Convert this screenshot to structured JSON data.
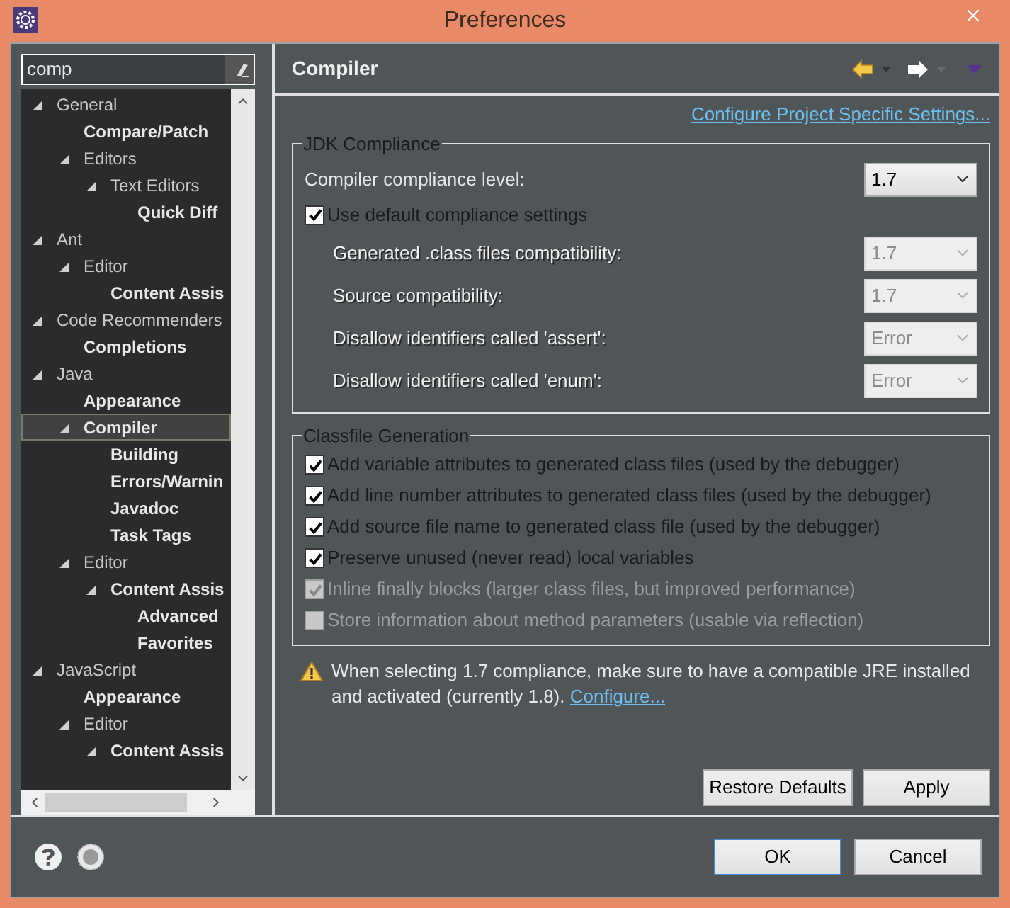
{
  "window": {
    "title": "Preferences"
  },
  "filter": {
    "value": "comp"
  },
  "tree": [
    {
      "label": "General",
      "matched": false,
      "expanded": true,
      "selected": false,
      "children": [
        {
          "label": "Compare/Patch",
          "matched": true,
          "selected": false
        },
        {
          "label": "Editors",
          "matched": false,
          "expanded": true,
          "selected": false,
          "children": [
            {
              "label": "Text Editors",
              "matched": false,
              "expanded": true,
              "selected": false,
              "children": [
                {
                  "label": "Quick Diff",
                  "matched": true,
                  "selected": false
                }
              ]
            }
          ]
        }
      ]
    },
    {
      "label": "Ant",
      "matched": false,
      "expanded": true,
      "selected": false,
      "children": [
        {
          "label": "Editor",
          "matched": false,
          "expanded": true,
          "selected": false,
          "children": [
            {
              "label": "Content Assis",
              "matched": true,
              "selected": false
            }
          ]
        }
      ]
    },
    {
      "label": "Code Recommenders",
      "matched": false,
      "expanded": true,
      "selected": false,
      "children": [
        {
          "label": "Completions",
          "matched": true,
          "selected": false
        }
      ]
    },
    {
      "label": "Java",
      "matched": false,
      "expanded": true,
      "selected": false,
      "children": [
        {
          "label": "Appearance",
          "matched": true,
          "selected": false
        },
        {
          "label": "Compiler",
          "matched": true,
          "expanded": true,
          "selected": true,
          "children": [
            {
              "label": "Building",
              "matched": true,
              "selected": false
            },
            {
              "label": "Errors/Warnin",
              "matched": true,
              "selected": false
            },
            {
              "label": "Javadoc",
              "matched": true,
              "selected": false
            },
            {
              "label": "Task Tags",
              "matched": true,
              "selected": false
            }
          ]
        },
        {
          "label": "Editor",
          "matched": false,
          "expanded": true,
          "selected": false,
          "children": [
            {
              "label": "Content Assis",
              "matched": true,
              "expanded": true,
              "selected": false,
              "children": [
                {
                  "label": "Advanced",
                  "matched": true,
                  "selected": false
                },
                {
                  "label": "Favorites",
                  "matched": true,
                  "selected": false
                }
              ]
            }
          ]
        }
      ]
    },
    {
      "label": "JavaScript",
      "matched": false,
      "expanded": true,
      "selected": false,
      "children": [
        {
          "label": "Appearance",
          "matched": true,
          "selected": false
        },
        {
          "label": "Editor",
          "matched": false,
          "expanded": true,
          "selected": false,
          "children": [
            {
              "label": "Content Assis",
              "matched": true,
              "expanded": true,
              "selected": false
            }
          ]
        }
      ]
    }
  ],
  "page": {
    "title": "Compiler",
    "link": "Configure Project Specific Settings..."
  },
  "jdk_compliance": {
    "title": "JDK Compliance",
    "level_label": "Compiler compliance level:",
    "level_value": "1.7",
    "use_default": {
      "label": "Use default compliance settings",
      "checked": true
    },
    "settings": [
      {
        "label": "Generated .class files compatibility:",
        "value": "1.7",
        "disabled": true
      },
      {
        "label": "Source compatibility:",
        "value": "1.7",
        "disabled": true
      },
      {
        "label": "Disallow identifiers called 'assert':",
        "value": "Error",
        "disabled": true
      },
      {
        "label": "Disallow identifiers called 'enum':",
        "value": "Error",
        "disabled": true
      }
    ]
  },
  "classfile_generation": {
    "title": "Classfile Generation",
    "options": [
      {
        "label": "Add variable attributes to generated class files (used by the debugger)",
        "checked": true,
        "disabled": false
      },
      {
        "label": "Add line number attributes to generated class files (used by the debugger)",
        "checked": true,
        "disabled": false
      },
      {
        "label": "Add source file name to generated class file (used by the debugger)",
        "checked": true,
        "disabled": false
      },
      {
        "label": "Preserve unused (never read) local variables",
        "checked": true,
        "disabled": false
      },
      {
        "label": "Inline finally blocks (larger class files, but improved performance)",
        "checked": true,
        "disabled": true
      },
      {
        "label": "Store information about method parameters (usable via reflection)",
        "checked": false,
        "disabled": true
      }
    ]
  },
  "warning": {
    "text": "When selecting 1.7 compliance, make sure to have a compatible JRE installed and activated (currently 1.8).",
    "link": "Configure..."
  },
  "page_buttons": [
    "Restore Defaults",
    "Apply"
  ],
  "dialog_buttons": [
    {
      "label": "OK",
      "default": true
    },
    {
      "label": "Cancel",
      "default": false
    }
  ]
}
